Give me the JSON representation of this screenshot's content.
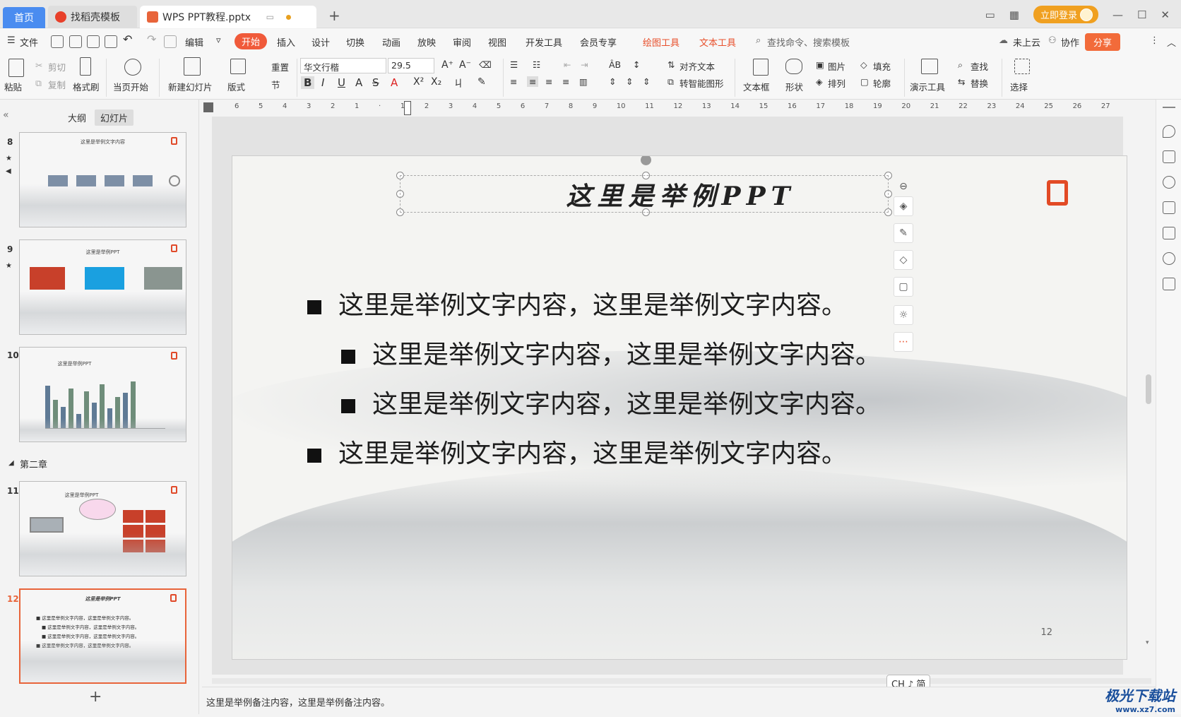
{
  "tabs": {
    "home": "首页",
    "template": "找稻壳模板",
    "document": "WPS PPT教程.pptx",
    "add": "+"
  },
  "titlebar": {
    "login": "立即登录"
  },
  "menu": {
    "file": "文件",
    "edit": "编辑",
    "start": "开始",
    "insert": "插入",
    "design": "设计",
    "switch": "切换",
    "animation": "动画",
    "slideshow": "放映",
    "review": "审阅",
    "view": "视图",
    "devtools": "开发工具",
    "member": "会员专享",
    "draw_tools": "绘图工具",
    "text_tools": "文本工具",
    "search": "查找命令、搜索模板",
    "cloud": "未上云",
    "collab": "协作",
    "share": "分享"
  },
  "ribbon": {
    "paste": "粘贴",
    "cut": "剪切",
    "copy": "复制",
    "format_painter": "格式刷",
    "from_first": "当页开始",
    "new_slide": "新建幻灯片",
    "layout": "版式",
    "reset": "重置",
    "section": "节",
    "font_name": "华文行楷",
    "font_size": "29.5",
    "align_text": "对齐文本",
    "smart_shape": "转智能图形",
    "textbox": "文本框",
    "shape": "形状",
    "picture": "图片",
    "arrange": "排列",
    "fill": "填充",
    "outline": "轮廓",
    "present_tools": "演示工具",
    "find": "查找",
    "replace": "替换",
    "select": "选择"
  },
  "left_panel": {
    "tab_outline": "大纲",
    "tab_slides": "幻灯片",
    "section_two": "第二章",
    "add": "+",
    "slides": [
      {
        "num": "8",
        "title": "这里是举例文字内容"
      },
      {
        "num": "9",
        "title": "这里是举例PPT"
      },
      {
        "num": "10",
        "title": "这里是举例PPT"
      },
      {
        "num": "11",
        "title": "这里是举例PPT"
      },
      {
        "num": "12",
        "title": "这里是举例PPT"
      }
    ]
  },
  "ruler": {
    "ticks": [
      "6",
      "5",
      "4",
      "3",
      "2",
      "1",
      "",
      "1",
      "2",
      "3",
      "4",
      "5",
      "6",
      "7",
      "8",
      "9",
      "10",
      "11",
      "12",
      "13",
      "14",
      "15",
      "16",
      "17",
      "18",
      "19",
      "20",
      "21",
      "22",
      "23",
      "24",
      "25",
      "26",
      "27"
    ]
  },
  "slide": {
    "title": "这里是举例PPT",
    "bullets": [
      {
        "level": 1,
        "text": "这里是举例文字内容，这里是举例文字内容。"
      },
      {
        "level": 2,
        "text": "这里是举例文字内容，这里是举例文字内容。"
      },
      {
        "level": 2,
        "text": "这里是举例文字内容，这里是举例文字内容。"
      },
      {
        "level": 1,
        "text": "这里是举例文字内容，这里是举例文字内容。"
      }
    ],
    "page_number": "12"
  },
  "notes": "这里是举例备注内容，这里是举例备注内容。",
  "ime": "CH ♪ 简",
  "watermark": {
    "name": "极光下载站",
    "url": "www.xz7.com"
  },
  "colors": {
    "accent": "#f05a3a",
    "home_tab": "#4a8cf0",
    "login": "#f0a020"
  }
}
